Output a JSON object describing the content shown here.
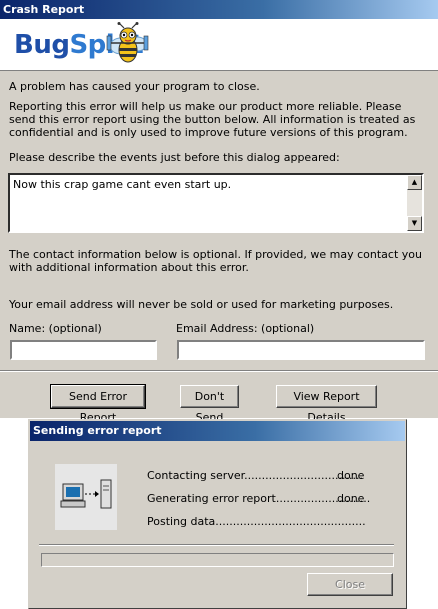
{
  "crash_window": {
    "title": "Crash Report",
    "logo": {
      "text_part1": "Bug",
      "text_part2": "Splat"
    },
    "intro": "A problem has caused your program to close.",
    "reporting_text": "Reporting this error will help us make our product more reliable.  Please send this error report using the button below.  All information is treated as confidential and is only used to improve future versions of this program.",
    "describe_label": "Please describe the events just before this dialog appeared:",
    "description_value": "Now this crap game cant even start up.",
    "contact_info": "The contact information below is optional. If provided, we may contact you with additional information about this error.",
    "privacy_note": "Your email address will never be sold or used for marketing purposes.",
    "name_label": "Name: (optional)",
    "name_value": "",
    "email_label": "Email Address: (optional)",
    "email_value": "",
    "buttons": {
      "send": "Send Error Report",
      "dont_send": "Don't Send",
      "view_details": "View Report Details"
    }
  },
  "sending_window": {
    "title": "Sending error report",
    "steps": [
      {
        "label": "Contacting server..................................",
        "result": "done"
      },
      {
        "label": "Generating error report...........................",
        "result": "done"
      },
      {
        "label": "Posting data...........................................",
        "result": ""
      }
    ],
    "progress_fraction": 0,
    "close_label": "Close"
  },
  "icons": [
    "bugsplat-bug-logo",
    "computer-to-server-icon",
    "scroll-up-arrow-icon",
    "scroll-down-arrow-icon"
  ],
  "colors": {
    "titlebar_start": "#0a246a",
    "titlebar_end": "#a6caf0",
    "dialog_bg": "#d4d0c8",
    "logo_blue": "#1f4fa8"
  }
}
